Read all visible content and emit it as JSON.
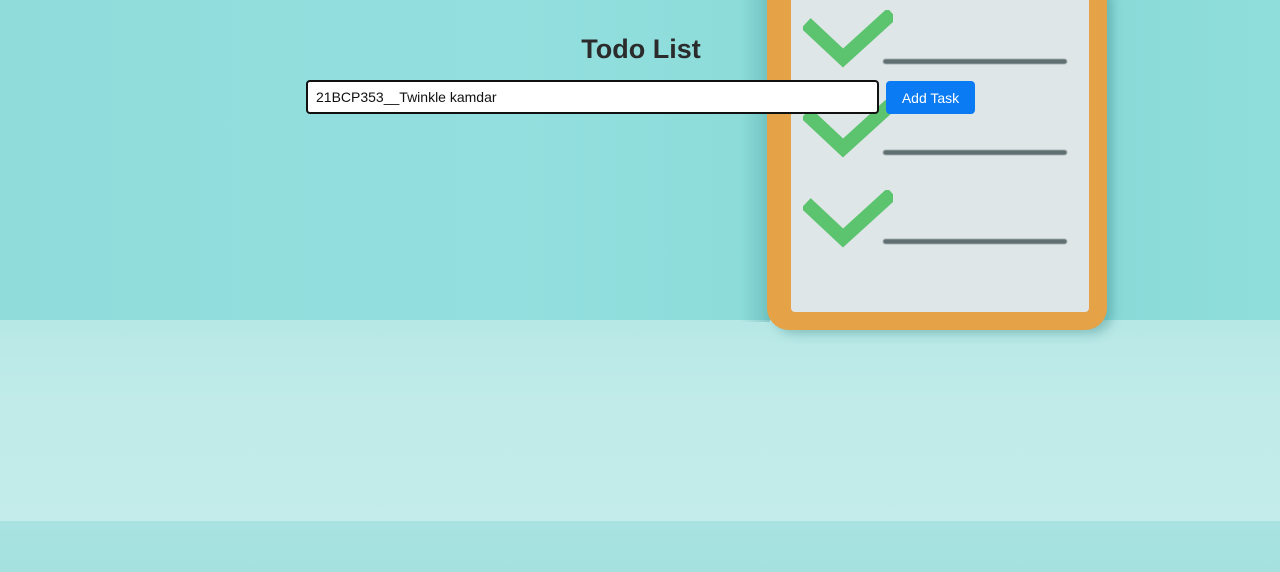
{
  "app": {
    "title": "Todo List"
  },
  "task_form": {
    "input_value": "21BCP353__Twinkle kamdar",
    "add_button_label": "Add Task"
  },
  "colors": {
    "button_bg": "#0b7bf4",
    "button_text": "#ffffff",
    "title_text": "#2b2b2b",
    "background_wall": "#8fdcd9",
    "clipboard_frame": "#e5a246",
    "checkmark": "#5cc46e"
  },
  "background_image": {
    "icon_names": [
      "clipboard-icon",
      "check-icon",
      "check-icon",
      "check-icon"
    ]
  }
}
